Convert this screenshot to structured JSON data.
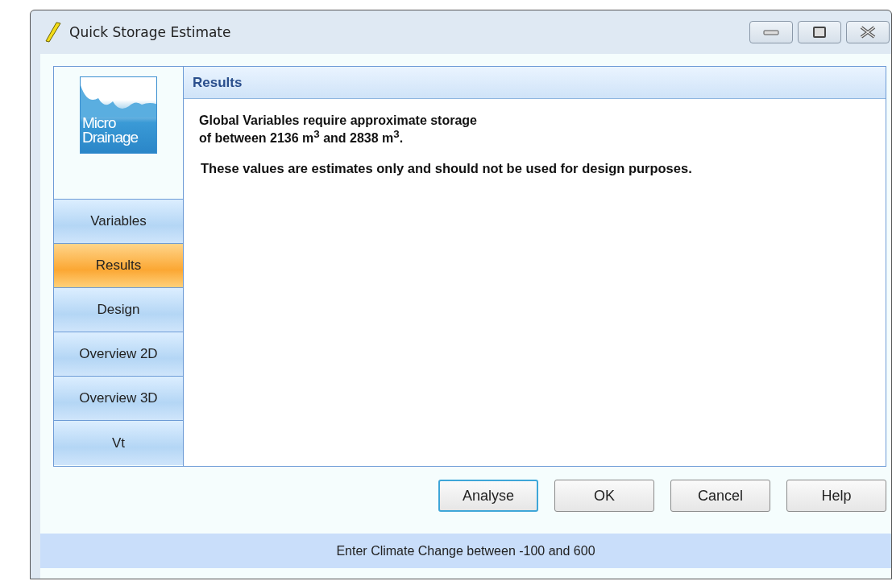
{
  "window": {
    "title": "Quick Storage Estimate"
  },
  "logo": {
    "lines": [
      "Micro",
      "Drainage"
    ]
  },
  "sidebar": {
    "items": [
      {
        "label": "Variables",
        "selected": false
      },
      {
        "label": "Results",
        "selected": true
      },
      {
        "label": "Design",
        "selected": false
      },
      {
        "label": "Overview 2D",
        "selected": false
      },
      {
        "label": "Overview 3D",
        "selected": false
      },
      {
        "label": "Vt",
        "selected": false
      }
    ]
  },
  "panel": {
    "title": "Results",
    "message": [
      "Global Variables require approximate storage",
      "of between 2136 m$^{3}$ and 2838 m$^{3}$."
    ],
    "note": "These values are estimates only and should not be used for design purposes."
  },
  "buttons": [
    {
      "label": "Analyse",
      "default": true
    },
    {
      "label": "OK",
      "default": false
    },
    {
      "label": "Cancel",
      "default": false
    },
    {
      "label": "Help",
      "default": false
    }
  ],
  "status_bar": "Enter Climate Change between -100 and 600"
}
